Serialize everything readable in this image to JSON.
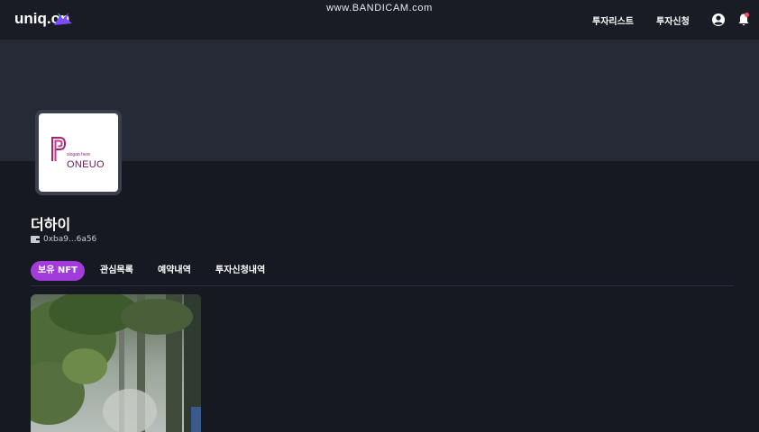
{
  "header": {
    "logo_text": "uniq.on",
    "nav": [
      "투자리스트",
      "투자신청"
    ],
    "icons": {
      "user": "user-circle-icon",
      "notifications": "bell-icon"
    }
  },
  "watermark": "www.BANDICAM.com",
  "profile": {
    "avatar": {
      "slogan": "slogan here",
      "brand": "ONEUO"
    },
    "name": "더하이",
    "wallet_address": "0xba9...6a56",
    "wallet_icon": "wallet-icon"
  },
  "tabs": [
    {
      "label": "보유 NFT",
      "active": true
    },
    {
      "label": "관심목록",
      "active": false
    },
    {
      "label": "예약내역",
      "active": false
    },
    {
      "label": "투자신청내역",
      "active": false
    }
  ],
  "colors": {
    "accent": "#a13bd9",
    "background": "#161922",
    "banner": "#262936"
  }
}
